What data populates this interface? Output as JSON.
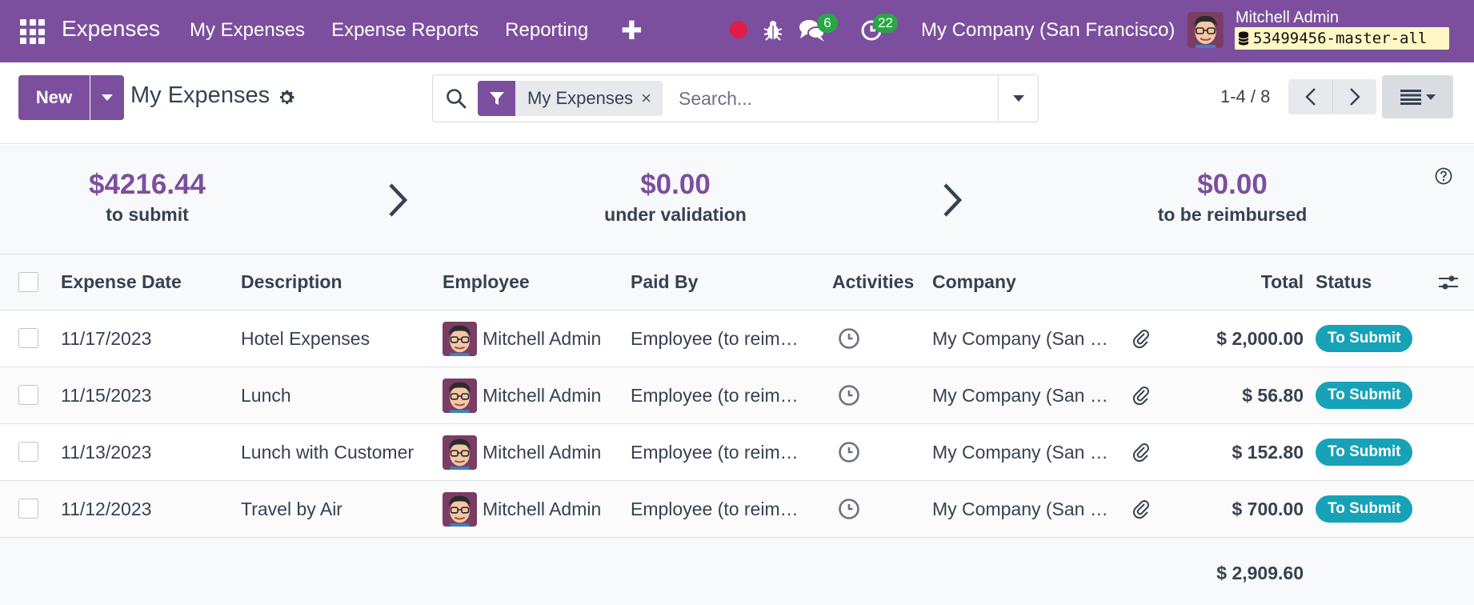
{
  "app": {
    "name": "Expenses"
  },
  "nav": {
    "items": [
      {
        "label": "My Expenses"
      },
      {
        "label": "Expense Reports"
      },
      {
        "label": "Reporting"
      }
    ],
    "messages_count": "6",
    "activities_count": "22",
    "company": "My Company (San Francisco)",
    "user_name": "Mitchell Admin",
    "database": "53499456-master-all"
  },
  "control": {
    "new_label": "New",
    "title": "My Expenses",
    "facet_label": "My Expenses",
    "facet_close": "×",
    "search_placeholder": "Search...",
    "pager": "1-4 / 8"
  },
  "summary": [
    {
      "amount": "$4216.44",
      "label": "to submit"
    },
    {
      "amount": "$0.00",
      "label": "under validation"
    },
    {
      "amount": "$0.00",
      "label": "to be reimbursed"
    }
  ],
  "table": {
    "columns": {
      "date": "Expense Date",
      "description": "Description",
      "employee": "Employee",
      "paid_by": "Paid By",
      "activities": "Activities",
      "company": "Company",
      "total": "Total",
      "status": "Status"
    },
    "rows": [
      {
        "date": "11/17/2023",
        "description": "Hotel Expenses",
        "employee": "Mitchell Admin",
        "paid_by": "Employee (to reim…",
        "company": "My Company (San …",
        "total": "$ 2,000.00",
        "status": "To Submit"
      },
      {
        "date": "11/15/2023",
        "description": "Lunch",
        "employee": "Mitchell Admin",
        "paid_by": "Employee (to reim…",
        "company": "My Company (San …",
        "total": "$ 56.80",
        "status": "To Submit"
      },
      {
        "date": "11/13/2023",
        "description": "Lunch with Customer",
        "employee": "Mitchell Admin",
        "paid_by": "Employee (to reim…",
        "company": "My Company (San …",
        "total": "$ 152.80",
        "status": "To Submit"
      },
      {
        "date": "11/12/2023",
        "description": "Travel by Air",
        "employee": "Mitchell Admin",
        "paid_by": "Employee (to reim…",
        "company": "My Company (San …",
        "total": "$ 700.00",
        "status": "To Submit"
      }
    ],
    "grand_total": "$ 2,909.60"
  },
  "colors": {
    "brand": "#7c4f9e",
    "status": "#17a2b8",
    "badge": "#28a745",
    "record": "#e11d48"
  },
  "icons": [
    "apps-grid-icon",
    "plus-icon",
    "record-icon",
    "bug-icon",
    "chat-icon",
    "activity-clock-icon",
    "database-icon",
    "gear-icon",
    "search-icon",
    "filter-icon",
    "chevron-left-icon",
    "chevron-right-icon",
    "list-view-icon",
    "chevron-right-large-icon",
    "help-icon",
    "clock-icon",
    "paperclip-icon",
    "column-options-icon"
  ]
}
